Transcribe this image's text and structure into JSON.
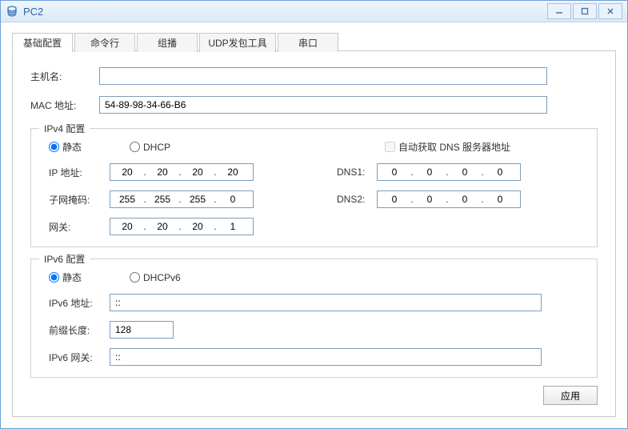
{
  "window": {
    "title": "PC2"
  },
  "tabs": [
    {
      "label": "基础配置",
      "active": true
    },
    {
      "label": "命令行"
    },
    {
      "label": "组播"
    },
    {
      "label": "UDP发包工具"
    },
    {
      "label": "串口"
    }
  ],
  "basic": {
    "hostname_label": "主机名:",
    "hostname_value": "",
    "mac_label": "MAC 地址:",
    "mac_value": "54-89-98-34-66-B6"
  },
  "ipv4": {
    "legend": "IPv4 配置",
    "radio_static": "静态",
    "radio_dhcp": "DHCP",
    "auto_dns_label": "自动获取 DNS 服务器地址",
    "ip_label": "IP 地址:",
    "ip": [
      "20",
      "20",
      "20",
      "20"
    ],
    "mask_label": "子网掩码:",
    "mask": [
      "255",
      "255",
      "255",
      "0"
    ],
    "gw_label": "网关:",
    "gw": [
      "20",
      "20",
      "20",
      "1"
    ],
    "dns1_label": "DNS1:",
    "dns1": [
      "0",
      "0",
      "0",
      "0"
    ],
    "dns2_label": "DNS2:",
    "dns2": [
      "0",
      "0",
      "0",
      "0"
    ]
  },
  "ipv6": {
    "legend": "IPv6 配置",
    "radio_static": "静态",
    "radio_dhcp": "DHCPv6",
    "addr_label": "IPv6 地址:",
    "addr_value": "::",
    "prefix_label": "前缀长度:",
    "prefix_value": "128",
    "gw_label": "IPv6 网关:",
    "gw_value": "::"
  },
  "buttons": {
    "apply": "应用"
  },
  "dot": "."
}
